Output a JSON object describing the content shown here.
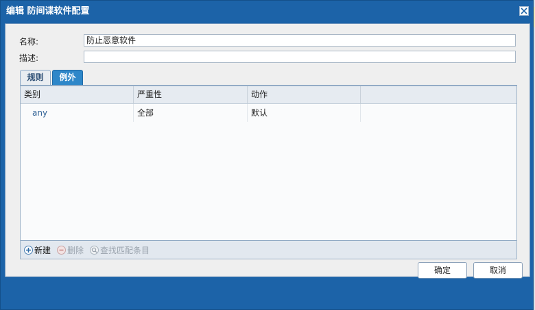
{
  "dialog": {
    "title": "编辑 防间谍软件配置",
    "name_label": "名称:",
    "name_value": "防止恶意软件",
    "description_label": "描述:",
    "description_value": ""
  },
  "tabs": [
    {
      "label": "规则",
      "active": false
    },
    {
      "label": "例外",
      "active": true
    }
  ],
  "grid": {
    "columns": [
      "类别",
      "严重性",
      "动作",
      ""
    ],
    "rows": [
      [
        "any",
        "全部",
        "默认",
        ""
      ]
    ]
  },
  "toolbar": {
    "new_label": "新建",
    "delete_label": "删除",
    "find_label": "查找匹配条目"
  },
  "footer": {
    "ok_label": "确定",
    "cancel_label": "取消"
  },
  "colors": {
    "frame": "#1c63a8",
    "active_tab": "#2e87c9"
  }
}
